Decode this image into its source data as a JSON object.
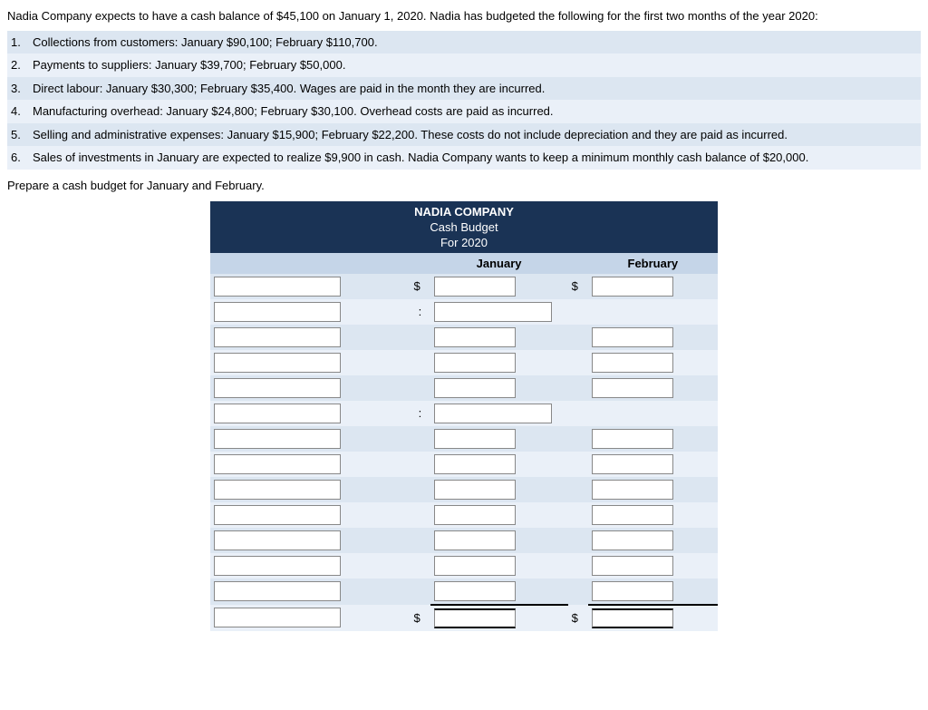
{
  "intro": {
    "text": "Nadia Company expects to have a cash balance of $45,100 on January 1, 2020. Nadia has budgeted the following for the first two months of the year 2020:"
  },
  "list_items": [
    {
      "num": "1.",
      "text": "Collections from customers: January $90,100; February $110,700."
    },
    {
      "num": "2.",
      "text": "Payments to suppliers: January $39,700; February $50,000."
    },
    {
      "num": "3.",
      "text": "Direct labour: January $30,300; February $35,400. Wages are paid in the month they are incurred."
    },
    {
      "num": "4.",
      "text": "Manufacturing overhead: January $24,800; February $30,100. Overhead costs are paid as incurred."
    },
    {
      "num": "5.",
      "text": "Selling and administrative expenses: January $15,900; February $22,200. These costs do not include depreciation and they are paid as incurred."
    },
    {
      "num": "6.",
      "text": "Sales of investments in January are expected to realize $9,900 in cash. Nadia Company wants to keep a minimum monthly cash balance of $20,000."
    }
  ],
  "prepare_text": "Prepare a cash budget for January and February.",
  "table": {
    "company": "NADIA COMPANY",
    "title": "Cash Budget",
    "period": "For 2020",
    "col_jan": "January",
    "col_feb": "February"
  },
  "icons": {}
}
